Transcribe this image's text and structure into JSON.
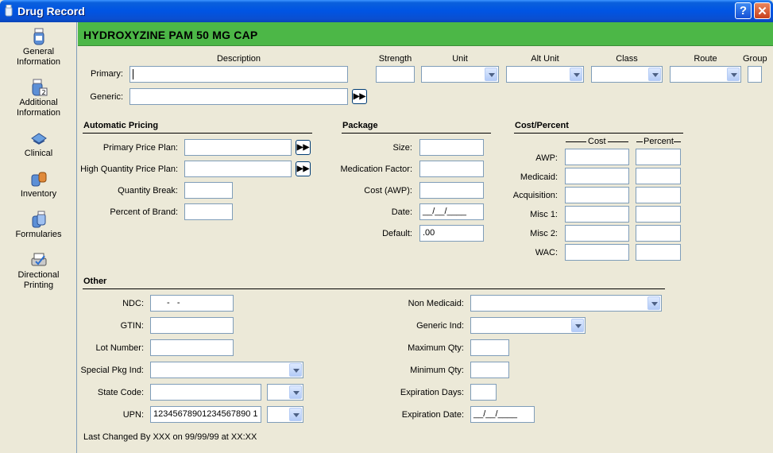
{
  "window": {
    "title": "Drug Record",
    "help_label": "?",
    "close_label": "✕"
  },
  "sidebar": [
    {
      "line1": "General",
      "line2": "Information",
      "icon": "general-information-icon"
    },
    {
      "line1": "Additional",
      "line2": "Information",
      "icon": "additional-information-icon"
    },
    {
      "line1": "Clinical",
      "line2": "",
      "icon": "clinical-icon"
    },
    {
      "line1": "Inventory",
      "line2": "",
      "icon": "inventory-icon"
    },
    {
      "line1": "Formularies",
      "line2": "",
      "icon": "formularies-icon"
    },
    {
      "line1": "Directional",
      "line2": "Printing",
      "icon": "directional-printing-icon"
    }
  ],
  "header": {
    "drug_name": "HYDROXYZINE PAM 50 MG CAP",
    "color": "#4cb747"
  },
  "description": {
    "col_description": "Description",
    "col_strength": "Strength",
    "col_unit": "Unit",
    "col_alt_unit": "Alt Unit",
    "col_class": "Class",
    "col_route": "Route",
    "col_group": "Group",
    "primary_label": "Primary:",
    "generic_label": "Generic:",
    "primary_value": "",
    "generic_value": "",
    "strength_value": "",
    "unit_value": "",
    "alt_unit_value": "",
    "class_value": "",
    "route_value": "",
    "group_value": ""
  },
  "pricing": {
    "title": "Automatic Pricing",
    "primary_price_plan": "Primary Price Plan:",
    "high_quantity_price_plan": "High Quantity Price Plan:",
    "quantity_break": "Quantity Break:",
    "percent_of_brand": "Percent of Brand:"
  },
  "package": {
    "title": "Package",
    "size": "Size:",
    "medication_factor": "Medication Factor:",
    "cost_awp": "Cost (AWP):",
    "date": "Date:",
    "date_value": "__/__/____",
    "default": "Default:",
    "default_value": ".00"
  },
  "cost_percent": {
    "title": "Cost/Percent",
    "col_cost": "Cost",
    "col_percent": "Percent",
    "rows": [
      "AWP:",
      "Medicaid:",
      "Acquisition:",
      "Misc 1:",
      "Misc 2:",
      "WAC:"
    ]
  },
  "other": {
    "title": "Other",
    "ndc": "NDC:",
    "ndc_value": "-   -",
    "gtin": "GTIN:",
    "lot_number": "Lot Number:",
    "special_pkg_ind": "Special Pkg Ind:",
    "state_code": "State Code:",
    "upn": "UPN:",
    "upn_value": "12345678901234567890 1",
    "non_medicaid": "Non Medicaid:",
    "generic_ind": "Generic Ind:",
    "maximum_qty": "Maximum Qty:",
    "minimum_qty": "Minimum Qty:",
    "expiration_days": "Expiration Days:",
    "expiration_date": "Expiration Date:",
    "expiration_date_value": "__/__/____"
  },
  "footer": {
    "last_changed": "Last Changed By XXX on 99/99/99 at XX:XX"
  }
}
